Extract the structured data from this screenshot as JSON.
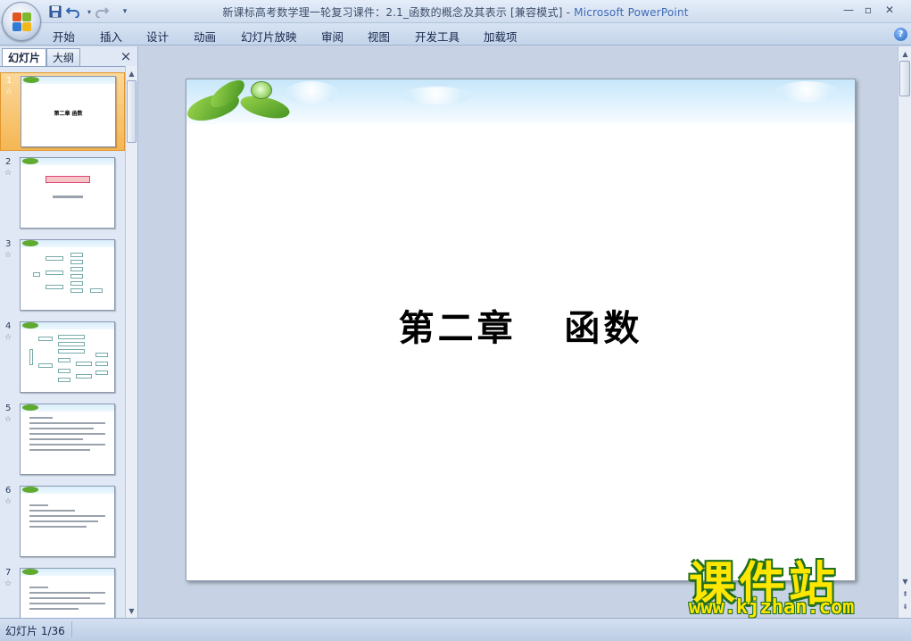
{
  "window": {
    "title_doc": "新课标高考数学理一轮复习课件：2.1_函数的概念及其表示 [兼容模式] - ",
    "title_app": "Microsoft PowerPoint",
    "minimize": "—",
    "restore": "▫",
    "close": "✕"
  },
  "quick_access": {
    "save_icon": "save-icon",
    "undo_icon": "undo-icon",
    "redo_icon": "redo-icon",
    "customize_icon": "chevron-down-icon"
  },
  "ribbon_tabs": [
    "开始",
    "插入",
    "设计",
    "动画",
    "幻灯片放映",
    "审阅",
    "视图",
    "开发工具",
    "加载项"
  ],
  "help": "?",
  "left_pane": {
    "tabs": [
      "幻灯片",
      "大纲"
    ],
    "close": "×",
    "slides": [
      {
        "num": "1",
        "title": "第二章   函数",
        "selected": true
      },
      {
        "num": "2",
        "title": "课程解读",
        "selected": false
      },
      {
        "num": "3",
        "title": "",
        "selected": false
      },
      {
        "num": "4",
        "title": "",
        "selected": false
      },
      {
        "num": "5",
        "title": "",
        "selected": false
      },
      {
        "num": "6",
        "title": "",
        "selected": false
      },
      {
        "num": "7",
        "title": "",
        "selected": false
      }
    ],
    "star": "☆"
  },
  "slide": {
    "title": "第二章   函数"
  },
  "status": {
    "slide_counter": "幻灯片 1/36"
  },
  "watermark": {
    "big": "课件站",
    "url": "www.kjzhan.com"
  },
  "colors": {
    "accent": "#3f6ab5",
    "selected_thumb": "#f5b654",
    "watermark": "#ffe600"
  }
}
